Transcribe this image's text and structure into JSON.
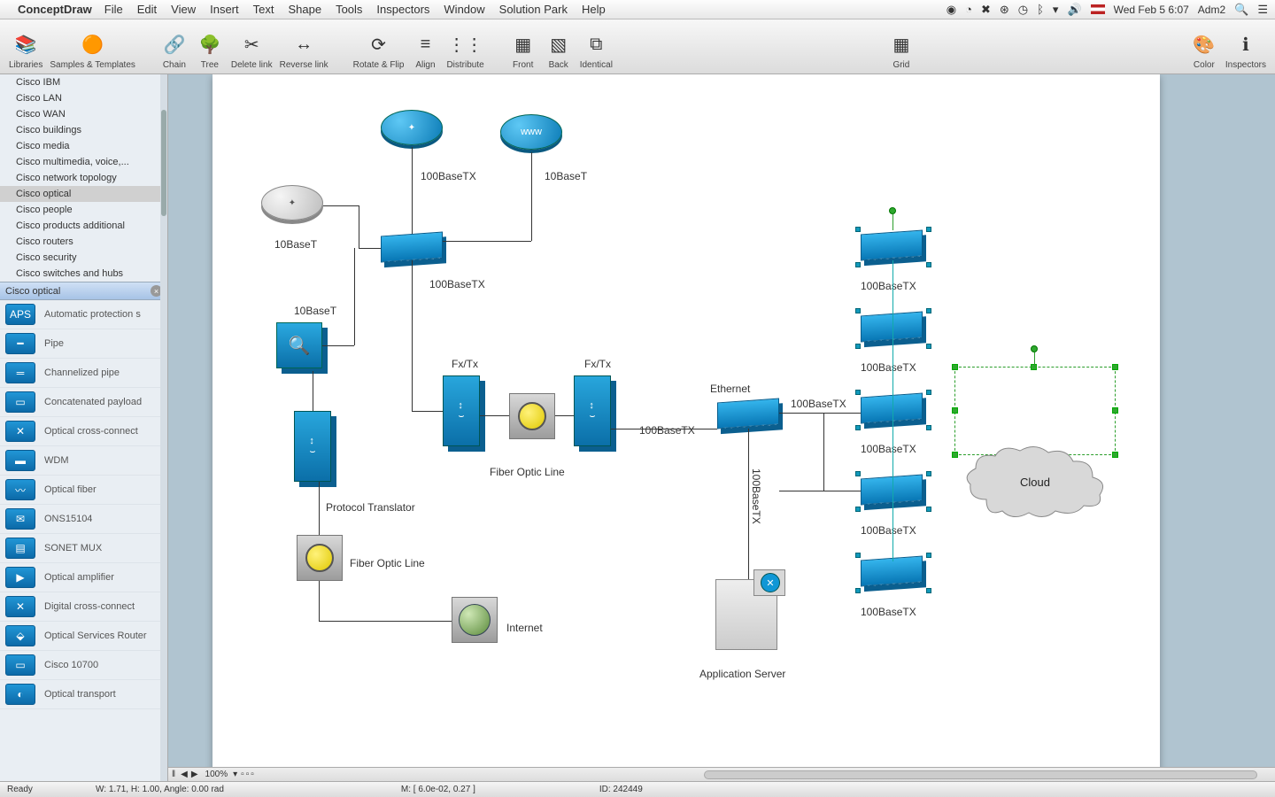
{
  "menubar": {
    "apple": "",
    "appname": "ConceptDraw",
    "items": [
      "File",
      "Edit",
      "View",
      "Insert",
      "Text",
      "Shape",
      "Tools",
      "Inspectors",
      "Window",
      "Solution Park",
      "Help"
    ],
    "right": {
      "datetime": "Wed Feb 5  6:07",
      "user": "Adm2"
    }
  },
  "toolbar": {
    "libraries": "Libraries",
    "samples": "Samples & Templates",
    "chain": "Chain",
    "tree": "Tree",
    "deletelink": "Delete link",
    "reverselink": "Reverse link",
    "rotateflip": "Rotate & Flip",
    "align": "Align",
    "distribute": "Distribute",
    "front": "Front",
    "back": "Back",
    "identical": "Identical",
    "grid": "Grid",
    "color": "Color",
    "inspectors": "Inspectors"
  },
  "sidebar": {
    "libs": [
      "Cisco IBM",
      "Cisco LAN",
      "Cisco WAN",
      "Cisco buildings",
      "Cisco media",
      "Cisco multimedia, voice,...",
      "Cisco network topology",
      "Cisco optical",
      "Cisco people",
      "Cisco products additional",
      "Cisco routers",
      "Cisco security",
      "Cisco switches and hubs"
    ],
    "selected_lib": "Cisco optical",
    "header_label": "Cisco optical",
    "shapes": [
      "Automatic protection s",
      "Pipe",
      "Channelized pipe",
      "Concatenated payload",
      "Optical cross-connect",
      "WDM",
      "Optical fiber",
      "ONS15104",
      "SONET MUX",
      "Optical amplifier",
      "Digital cross-connect",
      "Optical Services Router",
      "Cisco 10700",
      "Optical transport"
    ]
  },
  "diagram": {
    "labels": {
      "l100btx_top": "100BaseTX",
      "l10bt_top": "10BaseT",
      "l10bt_gray": "10BaseT",
      "l100btx_sw": "100BaseTX",
      "l10bt_cube": "10BaseT",
      "fxtx1": "Fx/Tx",
      "fxtx2": "Fx/Tx",
      "fiberline1": "Fiber Optic Line",
      "prot": "Protocol Translator",
      "fiberline2": "Fiber Optic Line",
      "internet": "Internet",
      "ethernet": "Ethernet",
      "l100btx_eth": "100BaseTX",
      "l100btx_mid": "100BaseTX",
      "l100btx_down": "100BaseTX",
      "appserver": "Application Server",
      "stack1": "100BaseTX",
      "stack2": "100BaseTX",
      "stack3": "100BaseTX",
      "stack4": "100BaseTX",
      "stack5": "100BaseTX",
      "cloud": "Cloud",
      "www": "www"
    }
  },
  "bottom": {
    "zoom": "100%"
  },
  "status": {
    "ready": "Ready",
    "whang": "W: 1.71,  H: 1.00,  Angle: 0.00 rad",
    "mouse": "M: [ 6.0e-02, 0.27 ]",
    "id": "ID: 242449"
  }
}
